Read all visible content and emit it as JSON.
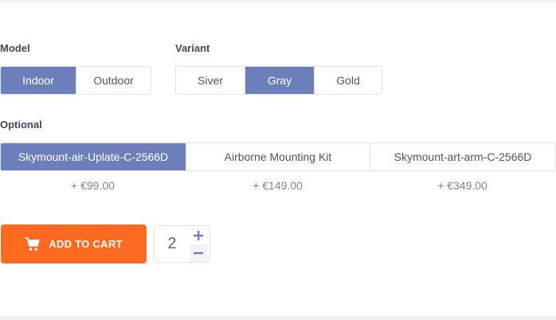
{
  "model": {
    "label": "Model",
    "options": [
      "Indoor",
      "Outdoor"
    ],
    "selected": "Indoor"
  },
  "variant": {
    "label": "Variant",
    "options": [
      "Siver",
      "Gray",
      "Gold"
    ],
    "selected": "Gray"
  },
  "optional": {
    "label": "Optional",
    "options": [
      {
        "name": "Skymount-air-Uplate-C-2566D",
        "price": "+ €99.00"
      },
      {
        "name": "Airborne Mounting Kit",
        "price": "+ €149.00"
      },
      {
        "name": "Skymount-art-arm-C-2566D",
        "price": "+ €349.00"
      }
    ],
    "selected": "Skymount-air-Uplate-C-2566D"
  },
  "cart": {
    "button_label": "ADD TO CART",
    "icon": "shopping-cart-icon"
  },
  "quantity": {
    "value": "2",
    "increment_icon": "plus-icon",
    "decrement_icon": "minus-icon"
  },
  "colors": {
    "accent": "#6d7fba",
    "cart": "#ff6a21",
    "stepper_icon": "#6d7fba"
  }
}
